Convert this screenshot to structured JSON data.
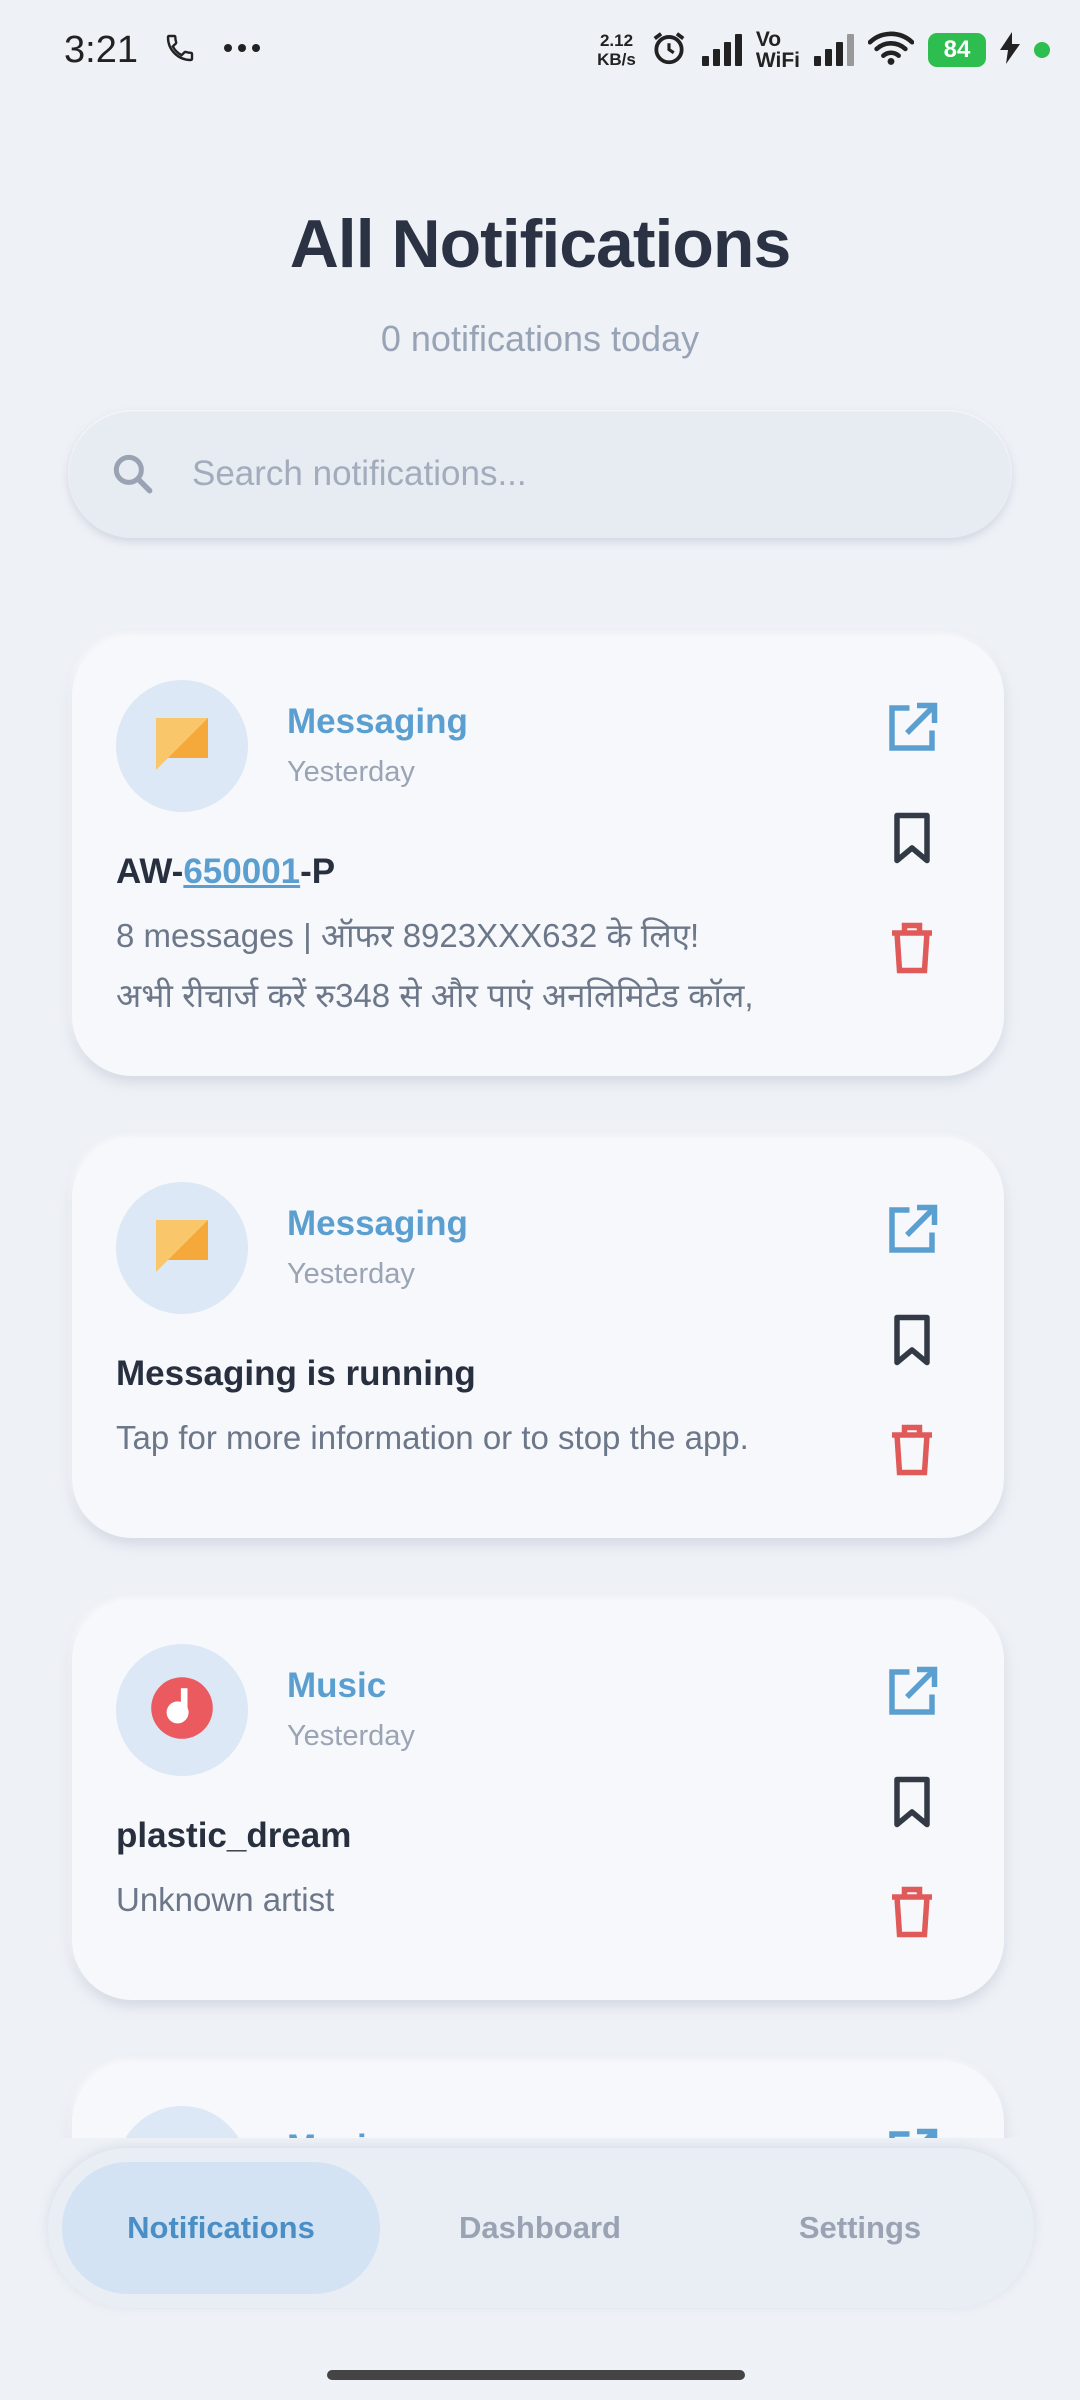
{
  "status_bar": {
    "time": "3:21",
    "net_speed_value": "2.12",
    "net_speed_unit": "KB/s",
    "vowifi_top": "Vo",
    "vowifi_bottom": "WiFi",
    "battery": "84"
  },
  "header": {
    "title": "All Notifications",
    "subtitle": "0 notifications today"
  },
  "search": {
    "placeholder": "Search notifications..."
  },
  "notifications": [
    {
      "app": "Messaging",
      "time": "Yesterday",
      "title_prefix": "AW-",
      "title_link": "650001",
      "title_suffix": "-P",
      "body_line1": "8 messages | ऑफर 8923XXX632 के लिए!",
      "body_line2": "अभी रीचार्ज करें रु348 से और पाएं अनलिमिटेड कॉल,"
    },
    {
      "app": "Messaging",
      "time": "Yesterday",
      "title": "Messaging is running",
      "body": "Tap for more information or to stop the app."
    },
    {
      "app": "Music",
      "time": "Yesterday",
      "title": "plastic_dream",
      "body": "Unknown artist"
    },
    {
      "app": "Music"
    }
  ],
  "nav": {
    "tab1": "Notifications",
    "tab2": "Dashboard",
    "tab3": "Settings"
  },
  "colors": {
    "accent": "#5a9fd0",
    "delete": "#e05a5a",
    "messaging_icon": "#f7b44a",
    "music_icon": "#ea5a5f"
  }
}
